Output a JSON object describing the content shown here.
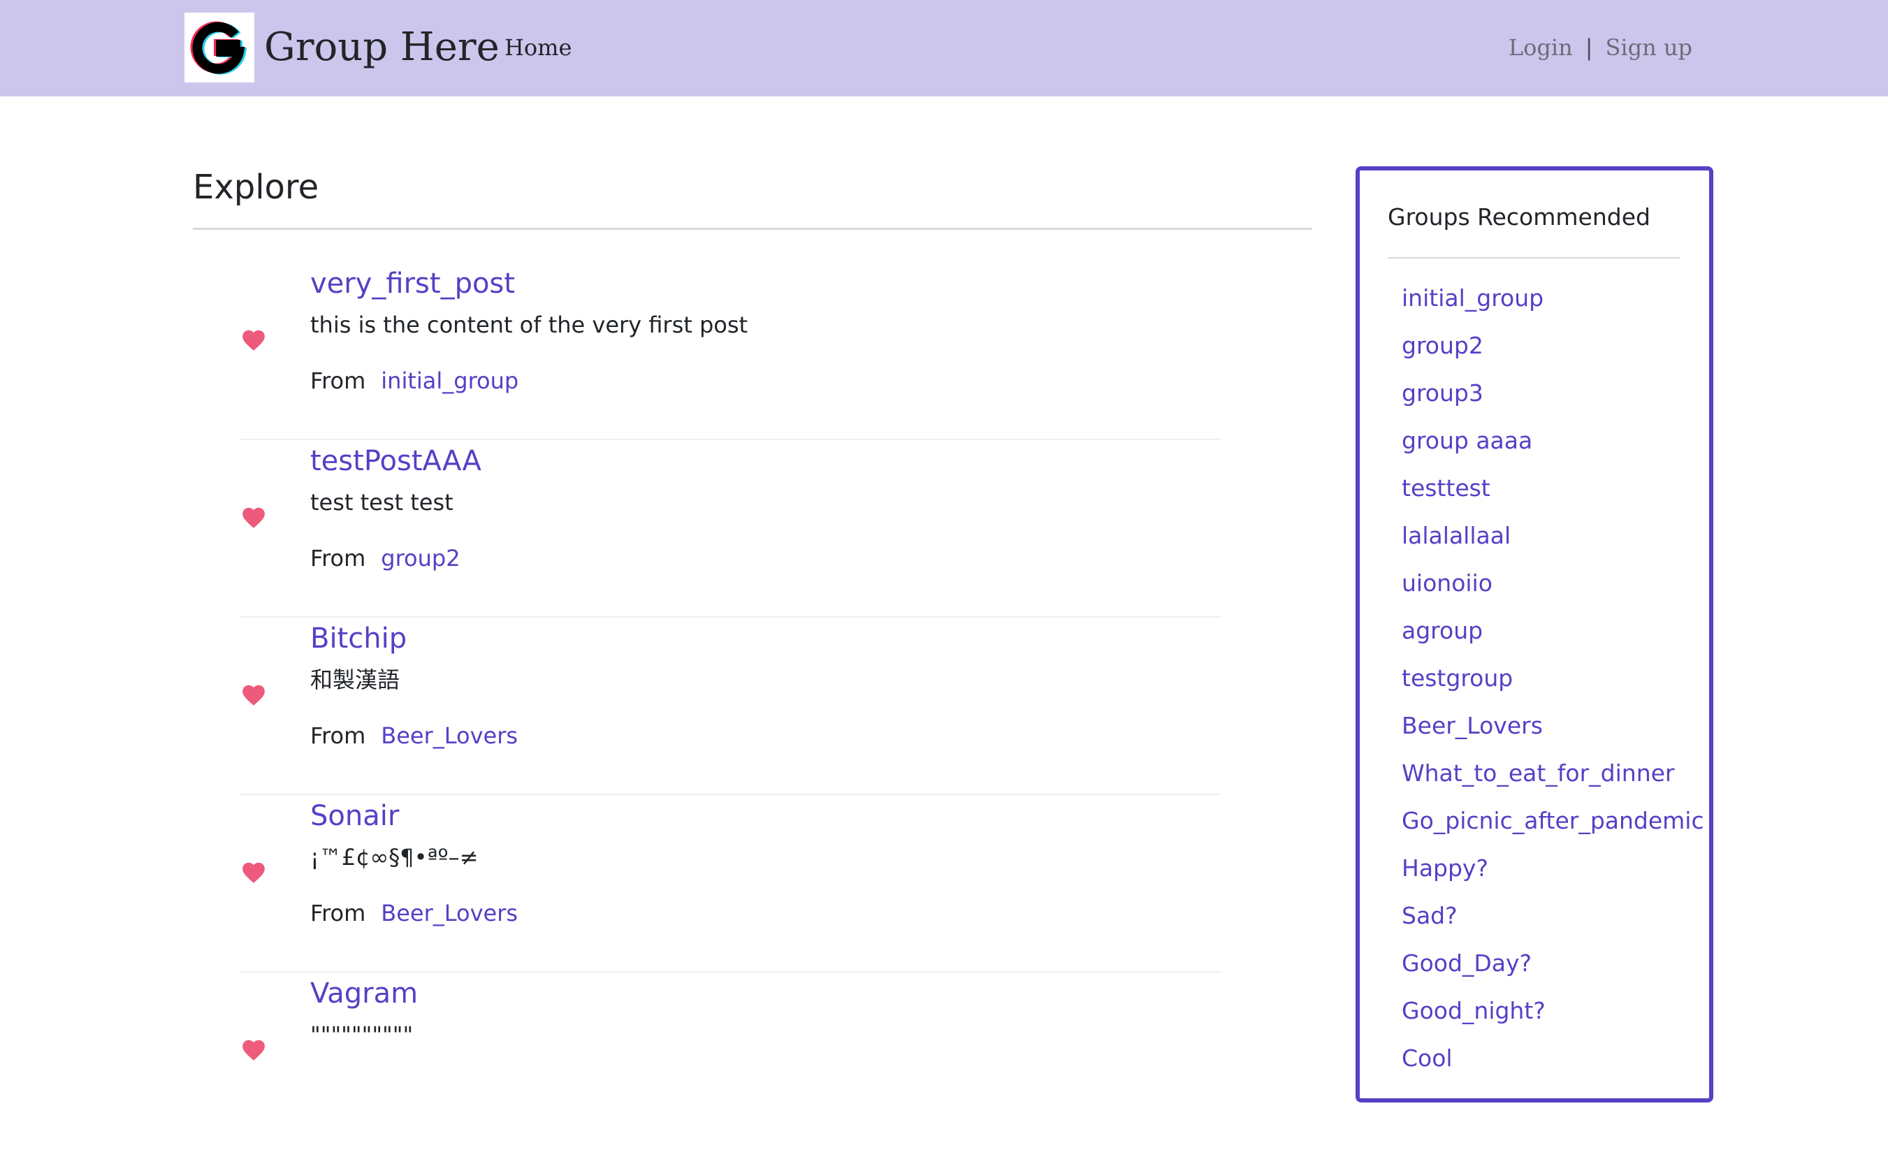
{
  "navbar": {
    "brand_name": "Group Here",
    "brand_logo_icon": "g-letter-logo-icon",
    "home_label": "Home",
    "login_label": "Login",
    "separator": "|",
    "signup_label": "Sign up",
    "background_color": "#cdc6ec"
  },
  "main": {
    "title": "Explore",
    "posts": [
      {
        "title": "very_first_post",
        "content": "this is the content of the very first post",
        "from_label": "From",
        "group": "initial_group",
        "icon": "heart-icon"
      },
      {
        "title": "testPostAAA",
        "content": "test test test",
        "from_label": "From",
        "group": "group2",
        "icon": "heart-icon"
      },
      {
        "title": "Bitchip",
        "content": "和製漢語",
        "from_label": "From",
        "group": "Beer_Lovers",
        "icon": "heart-icon"
      },
      {
        "title": "Sonair",
        "content": "¡™£¢∞§¶•ªº–≠",
        "from_label": "From",
        "group": "Beer_Lovers",
        "icon": "heart-icon"
      },
      {
        "title": "Vagram",
        "content": "\"\"\"\"\"\"\"\"\"\"",
        "icon": "heart-icon"
      }
    ]
  },
  "sidebar": {
    "title": "Groups Recommended",
    "groups": [
      "initial_group",
      "group2",
      "group3",
      "group aaaa",
      "testtest",
      "lalalallaal",
      "uionoiio",
      "agroup",
      "testgroup",
      "Beer_Lovers",
      "What_to_eat_for_dinner",
      "Go_picnic_after_pandemic",
      "Happy?",
      "Sad?",
      "Good_Day?",
      "Good_night?",
      "Cool"
    ]
  },
  "colors": {
    "accent": "#5540c6",
    "heart": "#ee5a7b",
    "sidebar_border": "#5540c6"
  }
}
